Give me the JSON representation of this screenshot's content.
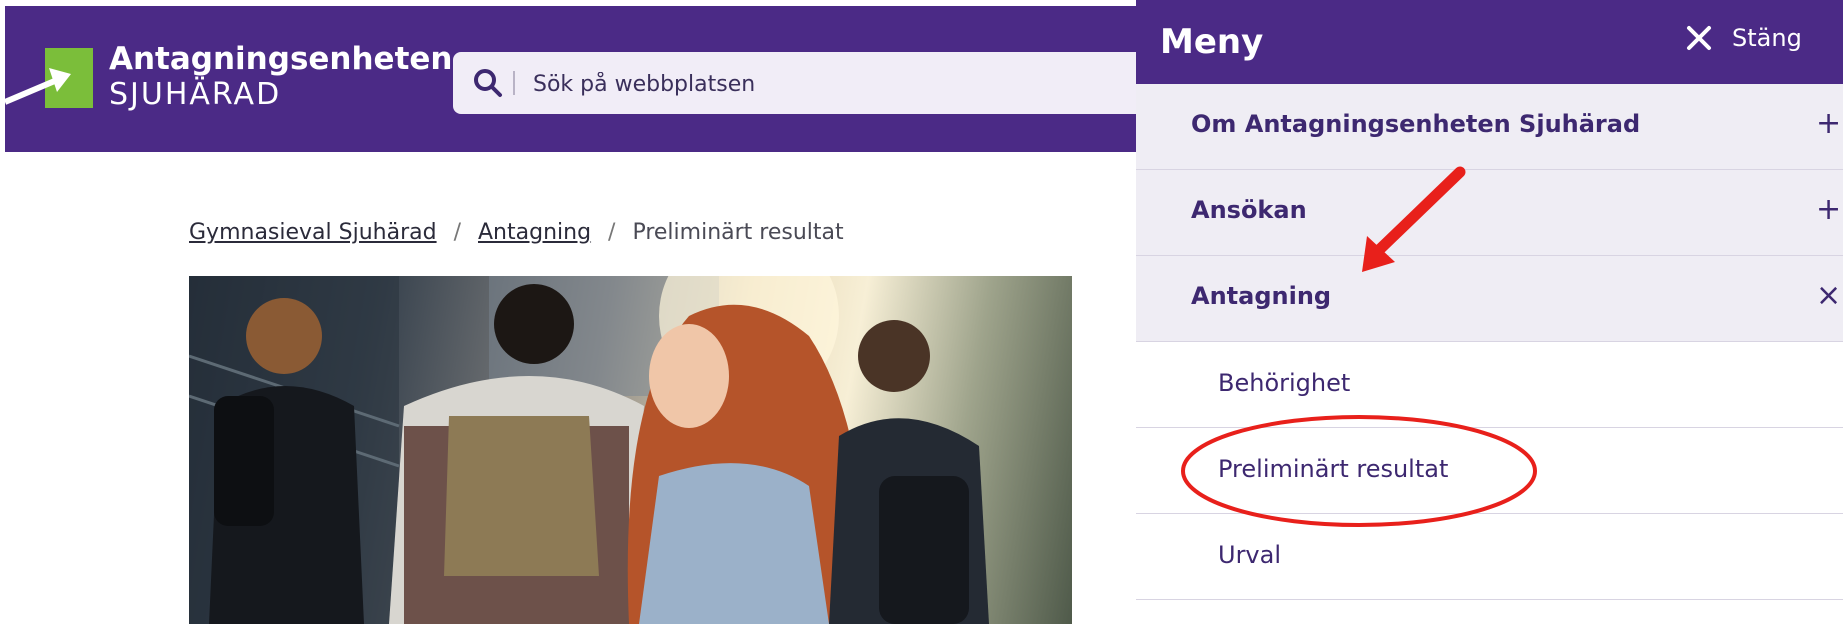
{
  "header": {
    "logo_title": "Antagningsenheten",
    "logo_subtitle": "SJUHÄRAD",
    "search_placeholder": "Sök på webbplatsen"
  },
  "breadcrumb": {
    "items": [
      "Gymnasieval Sjuhärad",
      "Antagning",
      "Preliminärt resultat"
    ],
    "separator": "/"
  },
  "menu": {
    "title": "Meny",
    "close_label": "Stäng",
    "items": [
      {
        "label": "Om Antagningsenheten Sjuhärad",
        "toggle": "+"
      },
      {
        "label": "Ansökan",
        "toggle": "+"
      },
      {
        "label": "Antagning",
        "toggle": "×"
      }
    ],
    "sub_items": [
      {
        "label": "Behörighet"
      },
      {
        "label": "Preliminärt resultat"
      },
      {
        "label": "Urval"
      }
    ]
  },
  "colors": {
    "brand_purple": "#4b2a86",
    "logo_green": "#7bbe3a",
    "annotation_red": "#e8201b"
  },
  "icons": {
    "search": "search-icon",
    "close": "close-icon",
    "logo_arrow": "arrow-icon"
  }
}
